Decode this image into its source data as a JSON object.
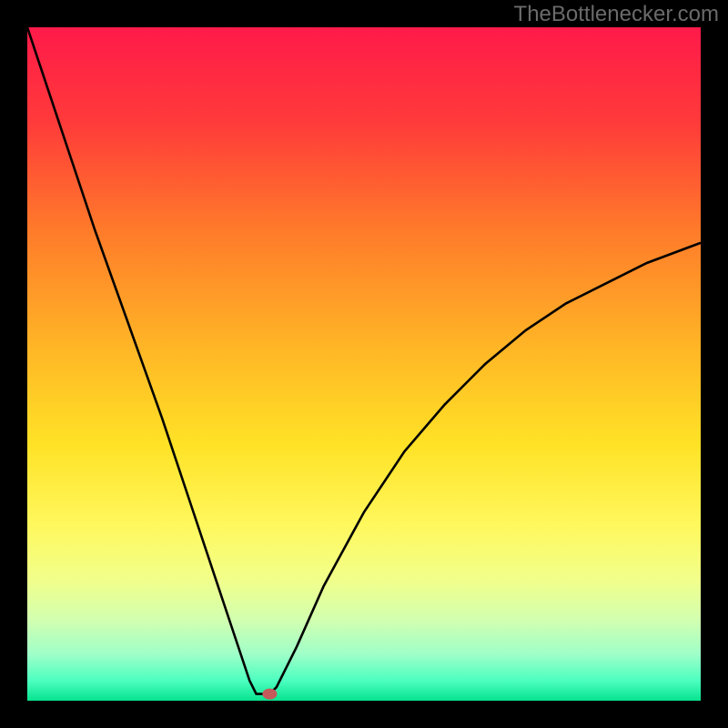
{
  "attribution": "TheBottlenecker.com",
  "chart_data": {
    "type": "line",
    "title": "",
    "xlabel": "",
    "ylabel": "",
    "xlim": [
      0,
      100
    ],
    "ylim": [
      0,
      100
    ],
    "curve_points": [
      {
        "x": 0,
        "y": 100
      },
      {
        "x": 5,
        "y": 85
      },
      {
        "x": 10,
        "y": 70
      },
      {
        "x": 15,
        "y": 56
      },
      {
        "x": 20,
        "y": 42
      },
      {
        "x": 24,
        "y": 30
      },
      {
        "x": 28,
        "y": 18
      },
      {
        "x": 31,
        "y": 9
      },
      {
        "x": 33,
        "y": 3
      },
      {
        "x": 34,
        "y": 1
      },
      {
        "x": 35,
        "y": 1
      },
      {
        "x": 36,
        "y": 1
      },
      {
        "x": 37,
        "y": 2
      },
      {
        "x": 40,
        "y": 8
      },
      {
        "x": 44,
        "y": 17
      },
      {
        "x": 50,
        "y": 28
      },
      {
        "x": 56,
        "y": 37
      },
      {
        "x": 62,
        "y": 44
      },
      {
        "x": 68,
        "y": 50
      },
      {
        "x": 74,
        "y": 55
      },
      {
        "x": 80,
        "y": 59
      },
      {
        "x": 86,
        "y": 62
      },
      {
        "x": 92,
        "y": 65
      },
      {
        "x": 100,
        "y": 68
      }
    ],
    "marker": {
      "x": 36,
      "y": 1
    },
    "gradient_stops": [
      {
        "pct": 0,
        "color": "#ff1a4a"
      },
      {
        "pct": 14,
        "color": "#ff3a3a"
      },
      {
        "pct": 30,
        "color": "#ff7a2a"
      },
      {
        "pct": 48,
        "color": "#ffb726"
      },
      {
        "pct": 62,
        "color": "#ffe226"
      },
      {
        "pct": 74,
        "color": "#fff85e"
      },
      {
        "pct": 82,
        "color": "#f1ff8a"
      },
      {
        "pct": 88,
        "color": "#d2ffb0"
      },
      {
        "pct": 93,
        "color": "#a0ffc8"
      },
      {
        "pct": 97,
        "color": "#4dffc0"
      },
      {
        "pct": 100,
        "color": "#06e38f"
      }
    ],
    "stroke_color": "#000000",
    "marker_color": "#c45a5a"
  }
}
